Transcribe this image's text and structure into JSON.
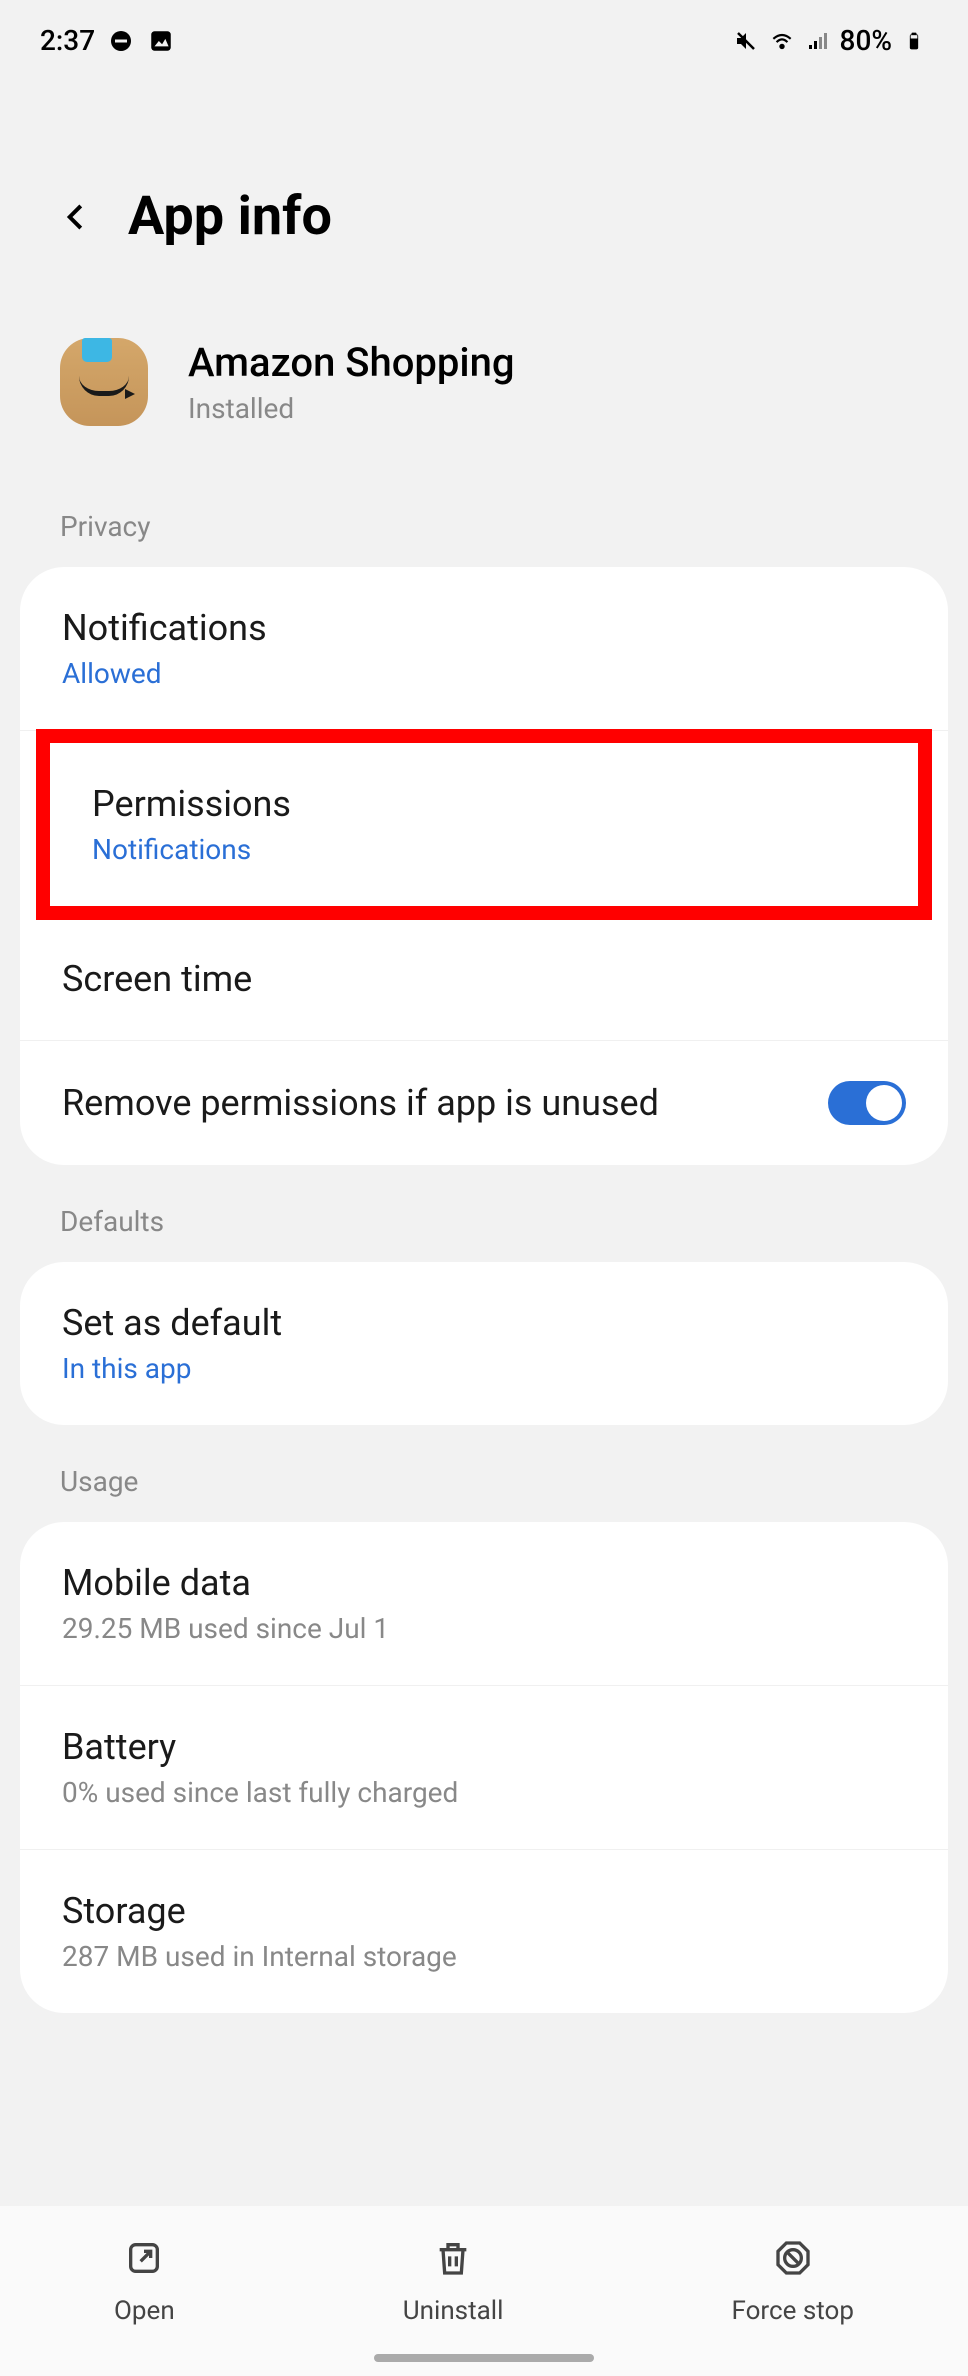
{
  "status": {
    "time": "2:37",
    "battery": "80%"
  },
  "header": {
    "title": "App info"
  },
  "app": {
    "name": "Amazon Shopping",
    "status": "Installed"
  },
  "sections": {
    "privacy": {
      "header": "Privacy",
      "items": {
        "notifications": {
          "title": "Notifications",
          "sub": "Allowed"
        },
        "permissions": {
          "title": "Permissions",
          "sub": "Notifications"
        },
        "screen_time": {
          "title": "Screen time"
        },
        "remove_perms": {
          "title": "Remove permissions if app is unused"
        }
      }
    },
    "defaults": {
      "header": "Defaults",
      "items": {
        "set_default": {
          "title": "Set as default",
          "sub": "In this app"
        }
      }
    },
    "usage": {
      "header": "Usage",
      "items": {
        "mobile_data": {
          "title": "Mobile data",
          "sub": "29.25 MB used since Jul 1"
        },
        "battery": {
          "title": "Battery",
          "sub": "0% used since last fully charged"
        },
        "storage": {
          "title": "Storage",
          "sub": "287 MB used in Internal storage"
        }
      }
    }
  },
  "bottom": {
    "open": "Open",
    "uninstall": "Uninstall",
    "force_stop": "Force stop"
  }
}
